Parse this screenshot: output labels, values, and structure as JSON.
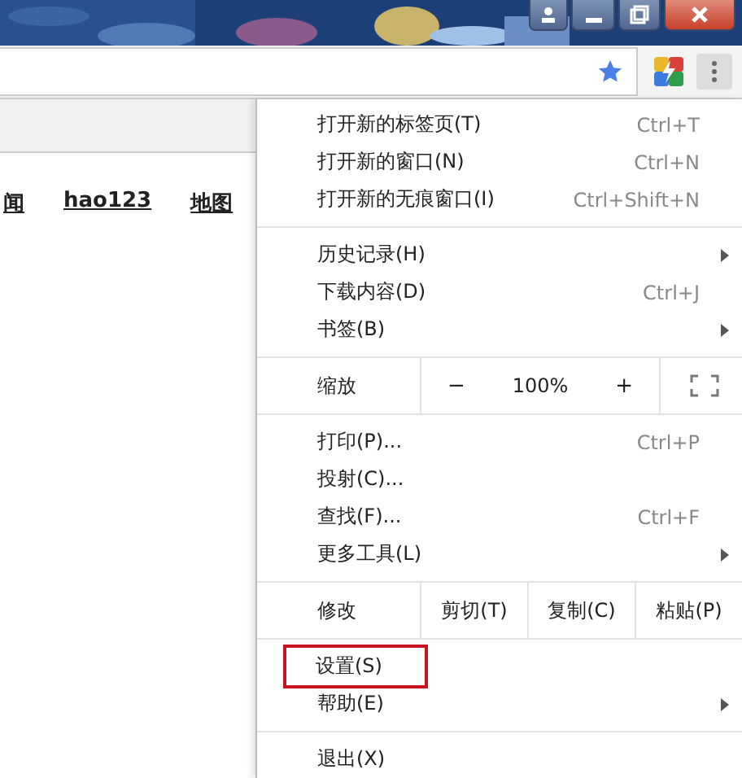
{
  "window_controls": [
    {
      "kind": "user"
    },
    {
      "kind": "minimize"
    },
    {
      "kind": "restore"
    },
    {
      "kind": "close"
    }
  ],
  "page": {
    "links": [
      "闻",
      "hao123",
      "地图"
    ]
  },
  "menu": {
    "sections": [
      [
        {
          "kind": "item",
          "label": "打开新的标签页(T)",
          "shortcut": "Ctrl+T"
        },
        {
          "kind": "item",
          "label": "打开新的窗口(N)",
          "shortcut": "Ctrl+N"
        },
        {
          "kind": "item",
          "label": "打开新的无痕窗口(I)",
          "shortcut": "Ctrl+Shift+N"
        }
      ],
      [
        {
          "kind": "item",
          "label": "历史记录(H)",
          "submenu": true
        },
        {
          "kind": "item",
          "label": "下载内容(D)",
          "shortcut": "Ctrl+J"
        },
        {
          "kind": "item",
          "label": "书签(B)",
          "submenu": true
        }
      ],
      [
        {
          "kind": "zoom",
          "label": "缩放",
          "minus": "−",
          "value": "100%",
          "plus": "+"
        }
      ],
      [
        {
          "kind": "item",
          "label": "打印(P)...",
          "shortcut": "Ctrl+P"
        },
        {
          "kind": "item",
          "label": "投射(C)..."
        },
        {
          "kind": "item",
          "label": "查找(F)...",
          "shortcut": "Ctrl+F"
        },
        {
          "kind": "item",
          "label": "更多工具(L)",
          "submenu": true
        }
      ],
      [
        {
          "kind": "edit",
          "label": "修改",
          "buttons": [
            "剪切(T)",
            "复制(C)",
            "粘贴(P)"
          ]
        }
      ],
      [
        {
          "kind": "item",
          "label": "设置(S)",
          "highlighted": true
        },
        {
          "kind": "item",
          "label": "帮助(E)",
          "submenu": true
        }
      ],
      [
        {
          "kind": "item",
          "label": "退出(X)"
        }
      ]
    ]
  }
}
